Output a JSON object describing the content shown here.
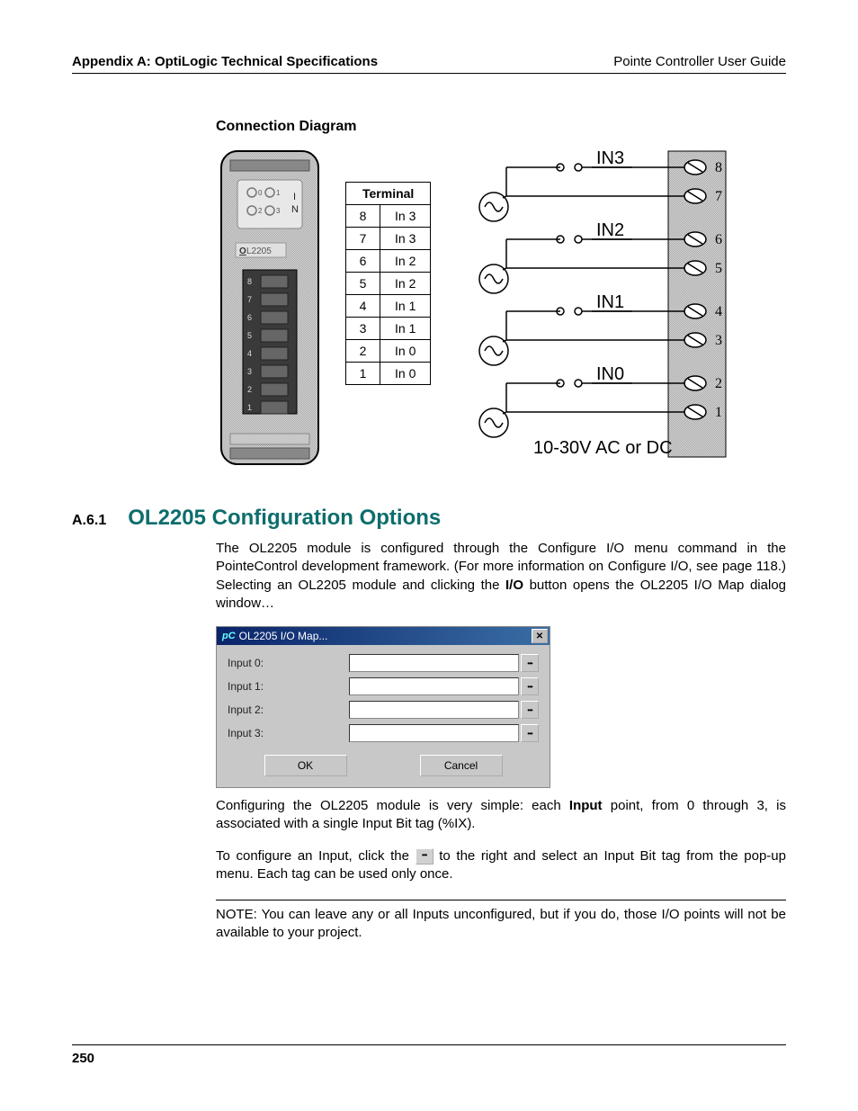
{
  "header": {
    "left": "Appendix A: OptiLogic Technical Specifications",
    "right": "Pointe Controller User Guide"
  },
  "diagram_title": "Connection Diagram",
  "module": {
    "leds": [
      "0",
      "1",
      "2",
      "3"
    ],
    "led_group_label": "I\nN",
    "part_label": "OL2205",
    "terminal_numbers": [
      "8",
      "7",
      "6",
      "5",
      "4",
      "3",
      "2",
      "1"
    ]
  },
  "terminal_table": {
    "header": "Terminal",
    "rows": [
      {
        "n": "8",
        "label": "In 3"
      },
      {
        "n": "7",
        "label": "In 3"
      },
      {
        "n": "6",
        "label": "In 2"
      },
      {
        "n": "5",
        "label": "In 2"
      },
      {
        "n": "4",
        "label": "In 1"
      },
      {
        "n": "3",
        "label": "In 1"
      },
      {
        "n": "2",
        "label": "In 0"
      },
      {
        "n": "1",
        "label": "In 0"
      }
    ]
  },
  "wiring": {
    "inputs": [
      "IN3",
      "IN2",
      "IN1",
      "IN0"
    ],
    "terminals": [
      "8",
      "7",
      "6",
      "5",
      "4",
      "3",
      "2",
      "1"
    ],
    "voltage": "10-30V  AC or DC"
  },
  "subsection": {
    "number": "A.6.1",
    "title": "OL2205 Configuration Options"
  },
  "para1_a": "The OL2205 module is configured through the Configure I/O menu command in the PointeControl development framework. (For more information on Configure I/O, see page 118.) Selecting an OL2205 module and clicking the ",
  "para1_bold": "I/O",
  "para1_b": " button opens the OL2205 I/O Map dialog window…",
  "dialog": {
    "title": "OL2205 I/O Map...",
    "rows": [
      "Input 0:",
      "Input 1:",
      "Input 2:",
      "Input 3:"
    ],
    "ok": "OK",
    "cancel": "Cancel"
  },
  "para2_a": "Configuring the OL2205 module is very simple: each ",
  "para2_bold": "Input",
  "para2_b": " point, from 0 through 3, is associated with a single Input Bit tag (%IX).",
  "para3_a": "To configure an Input, click the ",
  "para3_b": " to the right and select an Input Bit tag from the pop-up menu. Each tag can be used only once.",
  "note": "NOTE: You can leave any or all Inputs unconfigured, but if you do, those I/O points will not be available to your project.",
  "page_number": "250"
}
